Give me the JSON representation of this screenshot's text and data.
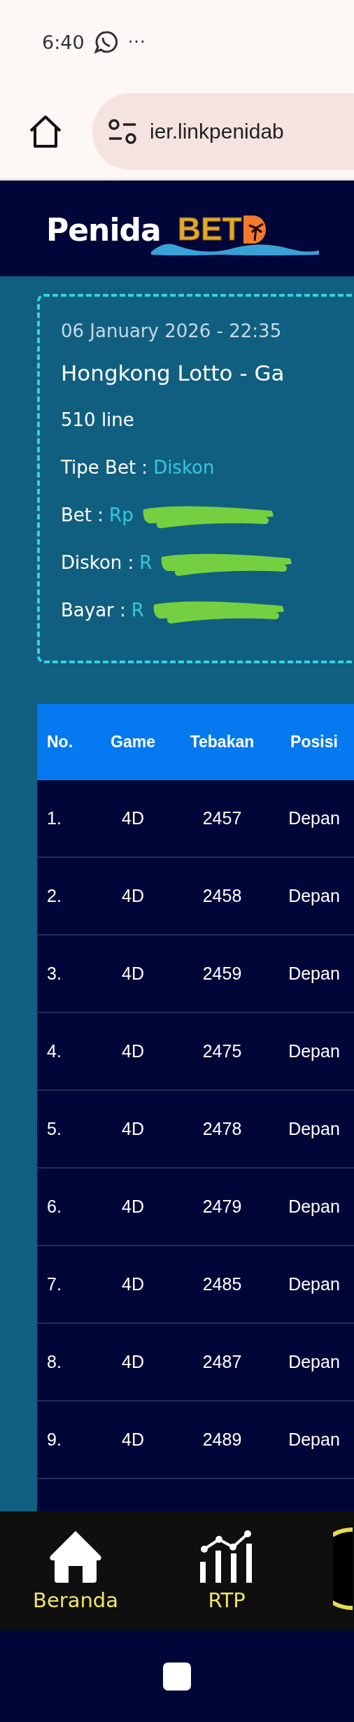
{
  "status_bar": {
    "time": "6:40",
    "more": "···"
  },
  "browser": {
    "url": "ier.linkpenidab"
  },
  "header": {
    "logo_part_1": "Penida",
    "logo_part_2": "BET"
  },
  "ticket": {
    "datetime": "06 January 2026 - 22:35",
    "title": "Hongkong Lotto - Ga",
    "lines": "510 line",
    "fields": [
      {
        "label": "Tipe Bet :",
        "value": "Diskon",
        "redacted": false
      },
      {
        "label": "Bet :",
        "value": "Rp",
        "redacted": true
      },
      {
        "label": "Diskon :",
        "value": "R",
        "redacted": true
      },
      {
        "label": "Bayar :",
        "value": "R",
        "redacted": true
      }
    ]
  },
  "table": {
    "columns": [
      "No.",
      "Game",
      "Tebakan",
      "Posisi"
    ],
    "rows": [
      [
        "1.",
        "4D",
        "2457",
        "Depan"
      ],
      [
        "2.",
        "4D",
        "2458",
        "Depan"
      ],
      [
        "3.",
        "4D",
        "2459",
        "Depan"
      ],
      [
        "4.",
        "4D",
        "2475",
        "Depan"
      ],
      [
        "5.",
        "4D",
        "2478",
        "Depan"
      ],
      [
        "6.",
        "4D",
        "2479",
        "Depan"
      ],
      [
        "7.",
        "4D",
        "2485",
        "Depan"
      ],
      [
        "8.",
        "4D",
        "2487",
        "Depan"
      ],
      [
        "9.",
        "4D",
        "2489",
        "Depan"
      ]
    ]
  },
  "bottom_nav": [
    {
      "kind": "home",
      "label": "Beranda"
    },
    {
      "kind": "chart",
      "label": "RTP"
    },
    {
      "kind": "ring"
    }
  ]
}
